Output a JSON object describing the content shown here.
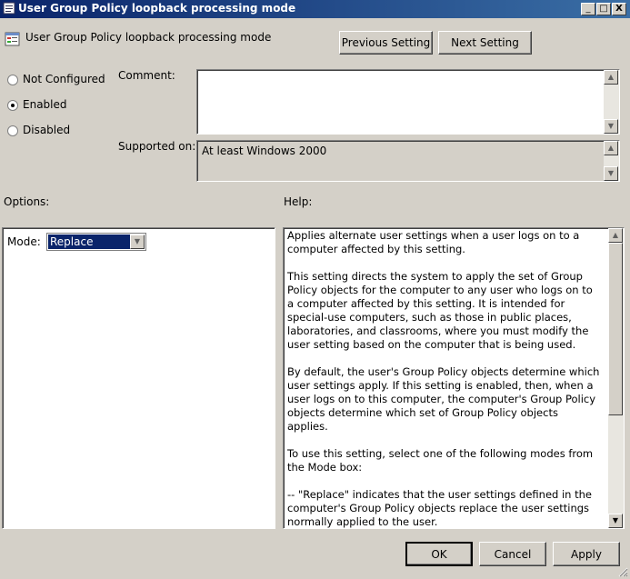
{
  "window": {
    "title": "User Group Policy loopback processing mode",
    "minimize": "_",
    "maximize": "□",
    "close": "X"
  },
  "header": {
    "setting_title": "User Group Policy loopback processing mode",
    "previous_label": "Previous Setting",
    "next_label": "Next Setting"
  },
  "state": {
    "options": [
      {
        "label": "Not Configured",
        "selected": false
      },
      {
        "label": "Enabled",
        "selected": true
      },
      {
        "label": "Disabled",
        "selected": false
      }
    ]
  },
  "comment": {
    "label": "Comment:",
    "value": ""
  },
  "supported": {
    "label": "Supported on:",
    "value": "At least Windows 2000"
  },
  "options_panel": {
    "label": "Options:",
    "mode_label": "Mode:",
    "mode_value": "Replace"
  },
  "help": {
    "label": "Help:",
    "text": "Applies alternate user settings when a user logs on to a computer affected by this setting.\n\nThis setting directs the system to apply the set of Group Policy objects for the computer to any user who logs on to a computer affected by this setting. It is intended for special-use computers, such as those in public places, laboratories, and classrooms, where you must modify the user setting based on the computer that is being used.\n\nBy default, the user's Group Policy objects determine which user settings apply. If this setting is enabled, then, when a user logs on to this computer, the computer's Group Policy objects determine which set of Group Policy objects applies.\n\nTo use this setting, select one of the following modes from the Mode box:\n\n--   \"Replace\" indicates that the user settings defined in the computer's Group Policy objects replace the user settings normally applied to the user."
  },
  "footer": {
    "ok_label": "OK",
    "cancel_label": "Cancel",
    "apply_label": "Apply"
  },
  "icons": [
    "policy-icon",
    "scroll-up-icon",
    "scroll-down-icon",
    "dropdown-arrow-icon"
  ]
}
